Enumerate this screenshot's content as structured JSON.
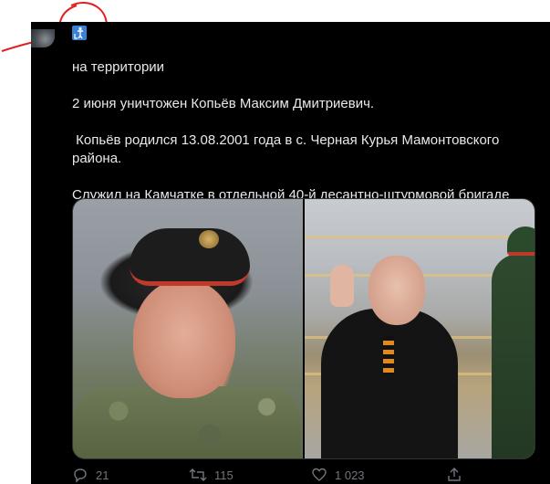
{
  "tweet": {
    "paragraphs": [
      {
        "before_flag": "на территории",
        "after_flag": "2 июня уничтожен Копьёв Максим Дмитриевич."
      },
      {
        "text": "Копьёв родился 13.08.2001 года в с. Черная Курья Мамонтовского района."
      },
      {
        "text": "Служил на Камчатке в отдельной 40-й десантно-штурмовой бригаде морской пехоты."
      }
    ],
    "flag_colors": {
      "top": "#0057b7",
      "bottom": "#ffd700"
    },
    "badge_icon": "accessibility-icon",
    "media": [
      {
        "name": "soldier-portrait-photo"
      },
      {
        "name": "putin-waving-photo"
      }
    ],
    "actions": {
      "reply": {
        "icon": "reply-icon",
        "count": "21"
      },
      "retweet": {
        "icon": "retweet-icon",
        "count": "115"
      },
      "like": {
        "icon": "heart-icon",
        "count": "1 023"
      },
      "share": {
        "icon": "share-icon"
      }
    }
  },
  "annotation": {
    "color": "#e02020"
  }
}
